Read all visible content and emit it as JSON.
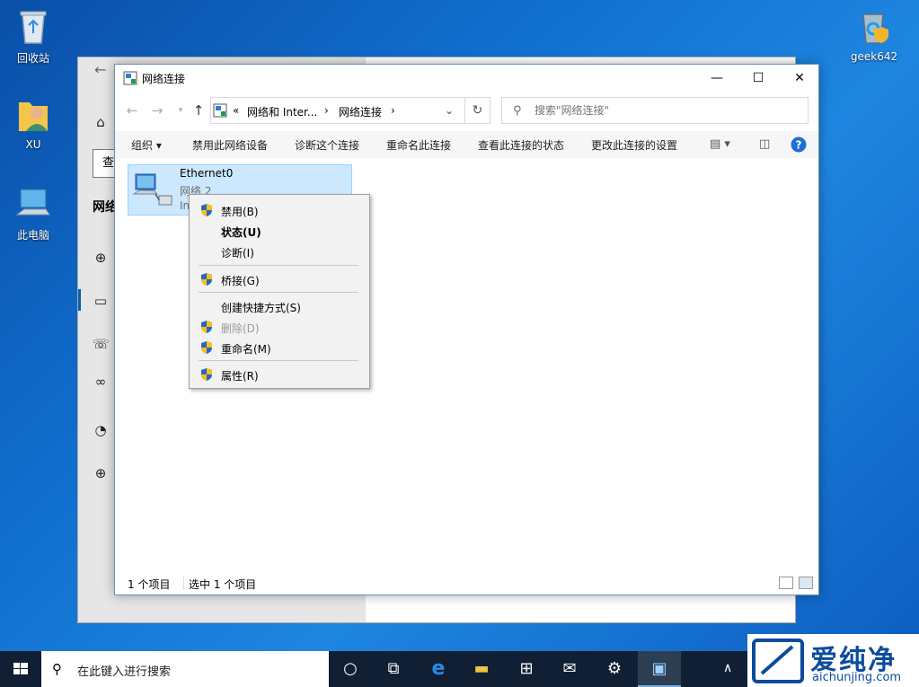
{
  "desktop": {
    "icons": [
      {
        "label": "回收站"
      },
      {
        "label": "XU"
      },
      {
        "label": "此电脑"
      },
      {
        "label": "geek642"
      }
    ]
  },
  "settings": {
    "search_text": "查",
    "heading": "网络"
  },
  "window": {
    "title": "网络连接",
    "controls": {
      "minimize": "—",
      "maximize": "☐",
      "close": "✕"
    },
    "address": {
      "overflow": "«",
      "crumbs": [
        "网络和 Inter...",
        "网络连接"
      ],
      "separator": "›"
    },
    "search": {
      "placeholder": "搜索\"网络连接\""
    },
    "toolbar": {
      "organize": "组织 ▾",
      "disable": "禁用此网络设备",
      "diagnose": "诊断这个连接",
      "rename": "重命名此连接",
      "view_status": "查看此连接的状态",
      "change_settings": "更改此连接的设置"
    },
    "item": {
      "name": "Ethernet0",
      "network": "网络 2",
      "adapter_partial": "Int"
    },
    "statusbar": {
      "count": "1 个项目",
      "selected": "选中 1 个项目"
    }
  },
  "context_menu": {
    "items": [
      {
        "label": "禁用(B)",
        "shield": true
      },
      {
        "label": "状态(U)",
        "bold": true
      },
      {
        "label": "诊断(I)"
      },
      {
        "label": "桥接(G)",
        "shield": true
      },
      {
        "label": "创建快捷方式(S)"
      },
      {
        "label": "删除(D)",
        "shield": true,
        "disabled": true
      },
      {
        "label": "重命名(M)",
        "shield": true
      },
      {
        "label": "属性(R)",
        "shield": true
      }
    ]
  },
  "taskbar": {
    "search_text": "在此键入进行搜索"
  },
  "brand": {
    "name": "爱纯净",
    "url": "aichunjing.com"
  },
  "colors": {
    "selection": "#cce8ff",
    "taskbar": "#101f33",
    "accent": "#0063b1"
  }
}
